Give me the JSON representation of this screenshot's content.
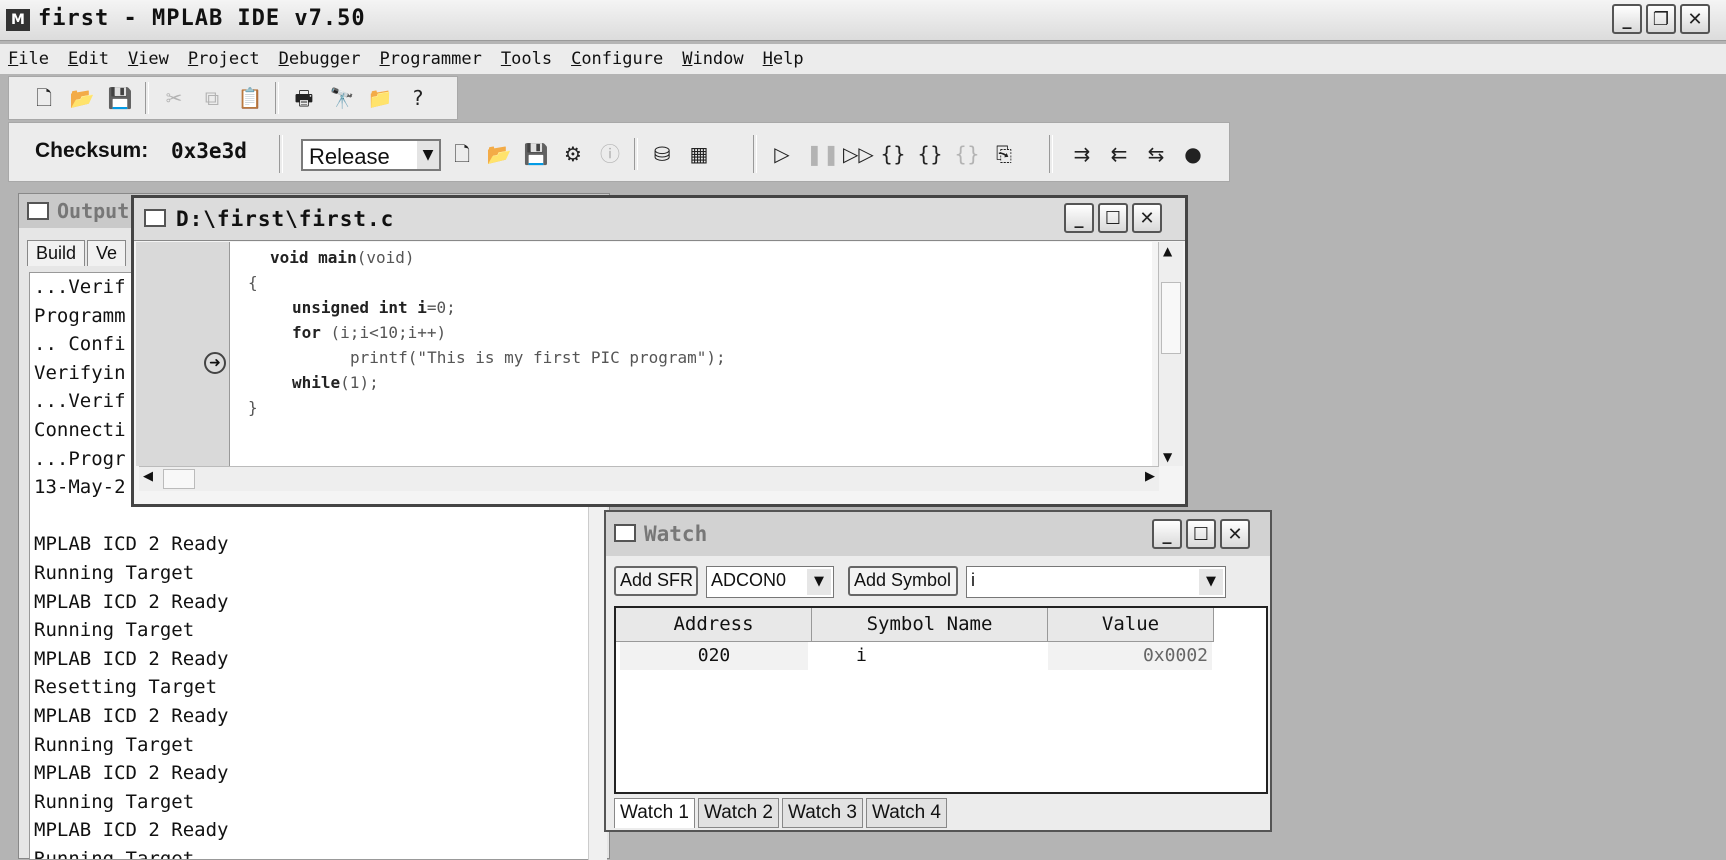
{
  "window": {
    "title": "first - MPLAB IDE v7.50",
    "logo_icon": "mplab-logo-icon"
  },
  "menubar": [
    "File",
    "Edit",
    "View",
    "Project",
    "Debugger",
    "Programmer",
    "Tools",
    "Configure",
    "Window",
    "Help"
  ],
  "toolbar": {
    "checksum_label": "Checksum:",
    "checksum_value": "0x3e3d",
    "build_config": "Release"
  },
  "output": {
    "title": "Output",
    "tabs": [
      "Build",
      "Ve"
    ],
    "lines": [
      "...Verif",
      "Programm",
      ".. Confi",
      "Verifyin",
      "...Verif",
      "Connecti",
      "...Progr",
      "13-May-2",
      "",
      "MPLAB ICD 2 Ready",
      "Running Target",
      "MPLAB ICD 2 Ready",
      "Running Target",
      "MPLAB ICD 2 Ready",
      "Resetting Target",
      "MPLAB ICD 2 Ready",
      "Running Target",
      "MPLAB ICD 2 Ready",
      "Running Target",
      "MPLAB ICD 2 Ready",
      "Running Target"
    ]
  },
  "editor": {
    "title": "D:\\first\\first.c",
    "code": {
      "l1_kw": "void main",
      "l1_rest": "(void)",
      "l2": "{",
      "l3_kw1": "unsigned int i",
      "l3_rest": "=0;",
      "l4_kw": "for",
      "l4_rest": " (i;i<10;i++)",
      "l5": "printf(\"This is my first PIC program\");",
      "l6_kw": "while",
      "l6_rest": "(1);",
      "l7": "}"
    }
  },
  "watch": {
    "title": "Watch",
    "add_sfr_label": "Add SFR",
    "sfr_selected": "ADCON0",
    "add_symbol_label": "Add Symbol",
    "symbol_selected": "i",
    "columns": [
      "Address",
      "Symbol Name",
      "Value"
    ],
    "rows": [
      {
        "address": "020",
        "symbol": "i",
        "value": "0x0002"
      }
    ],
    "tabs": [
      "Watch 1",
      "Watch 2",
      "Watch 3",
      "Watch 4"
    ]
  }
}
